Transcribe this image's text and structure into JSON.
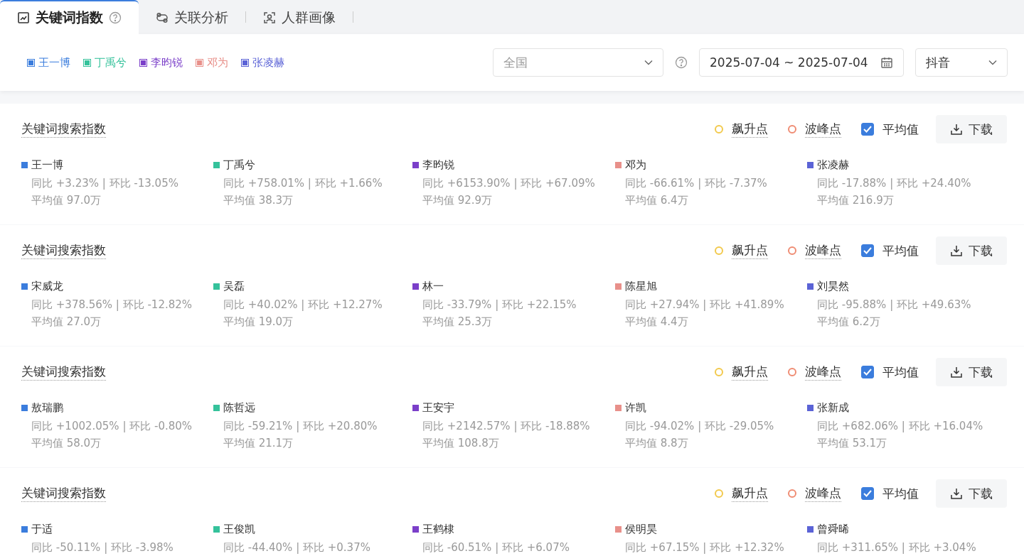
{
  "tabs": [
    {
      "label": "关键词指数",
      "kind": "chart",
      "selected": true,
      "help": true
    },
    {
      "label": "关联分析",
      "kind": "link",
      "selected": false,
      "help": false
    },
    {
      "label": "人群画像",
      "kind": "people",
      "selected": false,
      "help": false
    }
  ],
  "legend": [
    {
      "name": "王一博",
      "color": "#3b7ddd"
    },
    {
      "name": "丁禹兮",
      "color": "#35c29b"
    },
    {
      "name": "李昀锐",
      "color": "#7b3fc9"
    },
    {
      "name": "邓为",
      "color": "#e8908a"
    },
    {
      "name": "张凌赫",
      "color": "#5b63d6"
    }
  ],
  "region": {
    "placeholder": "全国"
  },
  "date_range": {
    "start": "2025-07-04",
    "separator": "~",
    "end": "2025-07-04"
  },
  "platform": {
    "value": "抖音"
  },
  "sections": [
    {
      "title": "关键词搜索指数",
      "toggles": [
        {
          "label": "飙升点",
          "kind": "dot",
          "color": "#f2c94c"
        },
        {
          "label": "波峰点",
          "kind": "dot",
          "color": "#ef8c73"
        },
        {
          "label": "平均值",
          "kind": "checkbox",
          "checked": true
        }
      ],
      "download": "下载",
      "items": [
        {
          "name": "王一博",
          "color": "#3b7ddd",
          "stats": "同比 +3.23% | 环比 -13.05%",
          "average": "平均值 97.0万"
        },
        {
          "name": "丁禹兮",
          "color": "#35c29b",
          "stats": "同比 +758.01% | 环比 +1.66%",
          "average": "平均值 38.3万"
        },
        {
          "name": "李昀锐",
          "color": "#7b3fc9",
          "stats": "同比 +6153.90% | 环比 +67.09%",
          "average": "平均值 92.9万"
        },
        {
          "name": "邓为",
          "color": "#e8908a",
          "stats": "同比 -66.61% | 环比 -7.37%",
          "average": "平均值 6.4万"
        },
        {
          "name": "张凌赫",
          "color": "#5b63d6",
          "stats": "同比 -17.88% | 环比 +24.40%",
          "average": "平均值 216.9万"
        }
      ]
    },
    {
      "title": "关键词搜索指数",
      "toggles": [
        {
          "label": "飙升点",
          "kind": "dot",
          "color": "#f2c94c"
        },
        {
          "label": "波峰点",
          "kind": "dot",
          "color": "#ef8c73"
        },
        {
          "label": "平均值",
          "kind": "checkbox",
          "checked": true
        }
      ],
      "download": "下载",
      "items": [
        {
          "name": "宋威龙",
          "color": "#3b7ddd",
          "stats": "同比 +378.56% | 环比 -12.82%",
          "average": "平均值 27.0万"
        },
        {
          "name": "吴磊",
          "color": "#35c29b",
          "stats": "同比 +40.02% | 环比 +12.27%",
          "average": "平均值 19.0万"
        },
        {
          "name": "林一",
          "color": "#7b3fc9",
          "stats": "同比 -33.79% | 环比 +22.15%",
          "average": "平均值 25.3万"
        },
        {
          "name": "陈星旭",
          "color": "#e8908a",
          "stats": "同比 +27.94% | 环比 +41.89%",
          "average": "平均值 4.4万"
        },
        {
          "name": "刘昊然",
          "color": "#5b63d6",
          "stats": "同比 -95.88% | 环比 +49.63%",
          "average": "平均值 6.2万"
        }
      ]
    },
    {
      "title": "关键词搜索指数",
      "toggles": [
        {
          "label": "飙升点",
          "kind": "dot",
          "color": "#f2c94c"
        },
        {
          "label": "波峰点",
          "kind": "dot",
          "color": "#ef8c73"
        },
        {
          "label": "平均值",
          "kind": "checkbox",
          "checked": true
        }
      ],
      "download": "下载",
      "items": [
        {
          "name": "敖瑞鹏",
          "color": "#3b7ddd",
          "stats": "同比 +1002.05% | 环比 -0.80%",
          "average": "平均值 58.0万"
        },
        {
          "name": "陈哲远",
          "color": "#35c29b",
          "stats": "同比 -59.21% | 环比 +20.80%",
          "average": "平均值 21.1万"
        },
        {
          "name": "王安宇",
          "color": "#7b3fc9",
          "stats": "同比 +2142.57% | 环比 -18.88%",
          "average": "平均值 108.8万"
        },
        {
          "name": "许凯",
          "color": "#e8908a",
          "stats": "同比 -94.02% | 环比 -29.05%",
          "average": "平均值 8.8万"
        },
        {
          "name": "张新成",
          "color": "#5b63d6",
          "stats": "同比 +682.06% | 环比 +16.04%",
          "average": "平均值 53.1万"
        }
      ]
    },
    {
      "title": "关键词搜索指数",
      "toggles": [
        {
          "label": "飙升点",
          "kind": "dot",
          "color": "#f2c94c"
        },
        {
          "label": "波峰点",
          "kind": "dot",
          "color": "#ef8c73"
        },
        {
          "label": "平均值",
          "kind": "checkbox",
          "checked": true
        }
      ],
      "download": "下载",
      "items": [
        {
          "name": "于适",
          "color": "#3b7ddd",
          "stats": "同比 -50.11% | 环比 -3.98%"
        },
        {
          "name": "王俊凯",
          "color": "#35c29b",
          "stats": "同比 -44.40% | 环比 +0.37%"
        },
        {
          "name": "王鹤棣",
          "color": "#7b3fc9",
          "stats": "同比 -60.51% | 环比 +6.07%"
        },
        {
          "name": "侯明昊",
          "color": "#e8908a",
          "stats": "同比 +67.15% | 环比 +12.32%"
        },
        {
          "name": "曾舜晞",
          "color": "#5b63d6",
          "stats": "同比 +311.65% | 环比 +3.04%"
        }
      ]
    }
  ]
}
